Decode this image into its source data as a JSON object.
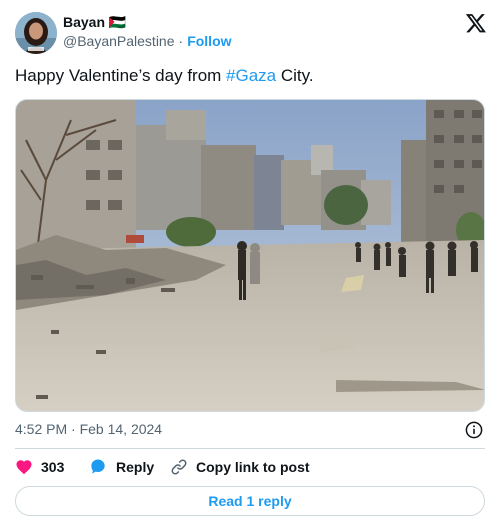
{
  "author": {
    "display_name": "Bayan 🇵🇸",
    "handle": "@BayanPalestine",
    "separator": "·",
    "follow_label": "Follow"
  },
  "tweet": {
    "text_before": "Happy Valentine’s day from ",
    "hashtag": "#Gaza",
    "text_after": " City."
  },
  "meta": {
    "timestamp": "4:52 PM · Feb 14, 2024"
  },
  "actions": {
    "like_count": "303",
    "reply_label": "Reply",
    "copy_label": "Copy link to post"
  },
  "footer": {
    "read_replies_label": "Read 1 reply"
  },
  "icons": {
    "brand": "x-logo-icon",
    "like": "heart-icon",
    "reply": "speech-bubble-icon",
    "copy": "link-icon",
    "info": "info-icon"
  },
  "colors": {
    "accent": "#1d9bf0",
    "like": "#f91880",
    "text": "#0f1419",
    "muted": "#536471",
    "border": "#cfd9de"
  }
}
